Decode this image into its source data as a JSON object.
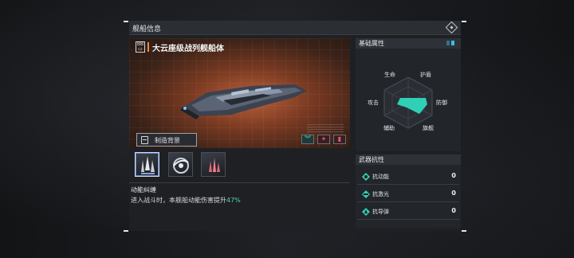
{
  "header": {
    "title": "舰船信息"
  },
  "ship": {
    "class_badge": "BB",
    "name": "大云座级战列舰船体"
  },
  "background_button": {
    "label": "制造背景"
  },
  "skills": [
    {
      "name": "skill-slot-1",
      "selected": true
    },
    {
      "name": "skill-slot-2",
      "selected": false
    },
    {
      "name": "skill-slot-3",
      "selected": false
    }
  ],
  "skill_detail": {
    "title": "动能纠缠",
    "description": "进入战斗时，本舰船动能伤害提升",
    "value": "47%"
  },
  "base_attributes": {
    "title": "基础属性",
    "labels": {
      "life": "生命",
      "shield": "护盾",
      "attack": "攻击",
      "defense": "防御",
      "assist": "辅助",
      "flagship": "旗舰"
    },
    "accent": "#2fd0b6"
  },
  "weapon_resistance": {
    "title": "武器抗性",
    "rows": [
      {
        "label": "抗动能",
        "value": "0",
        "icon": "kinetic-resist-icon"
      },
      {
        "label": "抗激光",
        "value": "0",
        "icon": "laser-resist-icon"
      },
      {
        "label": "抗导弹",
        "value": "0",
        "icon": "missile-resist-icon"
      }
    ]
  },
  "colors": {
    "accent_teal": "#2fd0b6",
    "accent_orange": "#f08a3c",
    "highlight_green": "#52d2b5"
  }
}
